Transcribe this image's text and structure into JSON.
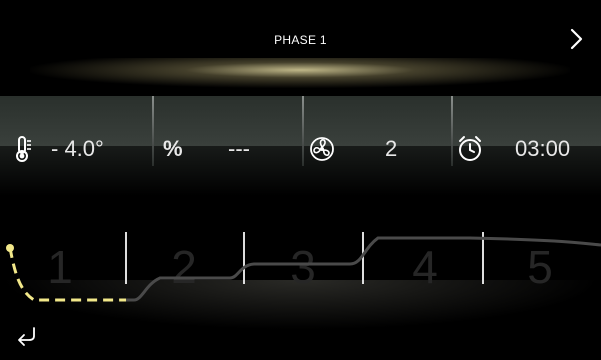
{
  "header": {
    "title": "PHASE 1",
    "next_icon": "chevron-right-icon"
  },
  "params": {
    "temperature": {
      "icon": "thermometer-icon",
      "value": "- 4.0°"
    },
    "humidity": {
      "icon": "percent-icon",
      "symbol": "%",
      "value": "---"
    },
    "fan": {
      "icon": "fan-icon",
      "value": "2"
    },
    "timer": {
      "icon": "alarm-clock-icon",
      "value": "03:00"
    }
  },
  "chart": {
    "phases": [
      "1",
      "2",
      "3",
      "4",
      "5"
    ],
    "active_phase": 1,
    "active_color": "#f2e88a",
    "curve_color": "#4a4a4a"
  },
  "footer": {
    "back_icon": "return-arrow-icon"
  }
}
